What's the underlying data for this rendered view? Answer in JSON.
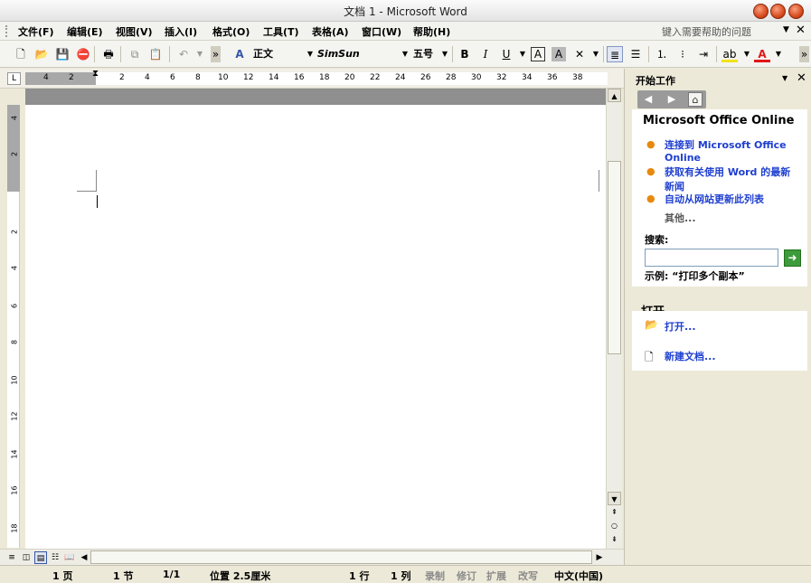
{
  "window": {
    "title": "文档 1 - Microsoft Word"
  },
  "menu": {
    "items": [
      "文件(F)",
      "编辑(E)",
      "视图(V)",
      "插入(I)",
      "格式(O)",
      "工具(T)",
      "表格(A)",
      "窗口(W)",
      "帮助(H)"
    ],
    "help_placeholder": "键入需要帮助的问题"
  },
  "toolbar": {
    "style": "正文",
    "font": "SimSun",
    "size": "五号"
  },
  "ruler": {
    "h_labels": [
      "4",
      "2",
      "2",
      "4",
      "6",
      "8",
      "10",
      "12",
      "14",
      "16",
      "18",
      "20",
      "22",
      "24",
      "26",
      "28",
      "30",
      "32",
      "34",
      "36",
      "38"
    ],
    "v_labels": [
      "4",
      "2",
      "2",
      "4",
      "6",
      "8",
      "10",
      "12",
      "14",
      "16",
      "18"
    ]
  },
  "statusbar": {
    "page": "1 页",
    "section": "1 节",
    "page_of": "1/1",
    "position": "位置 2.5厘米",
    "line": "1 行",
    "col": "1 列",
    "rec": "录制",
    "trk": "修订",
    "ext": "扩展",
    "ovr": "改写",
    "lang": "中文(中国)"
  },
  "task_pane": {
    "title": "开始工作",
    "office_online": {
      "heading": "Microsoft Office Online",
      "links": [
        "连接到 Microsoft Office Online",
        "获取有关使用 Word 的最新新闻",
        "自动从网站更新此列表"
      ],
      "more": "其他...",
      "search_label": "搜索:",
      "example": "示例: “打印多个副本”"
    },
    "open": {
      "heading": "打开",
      "open_link": "打开...",
      "new_link": "新建文档..."
    }
  },
  "colors": {
    "link": "#1e3fd0",
    "bullet": "#e8890e",
    "accent_go": "#3c9b3a"
  }
}
